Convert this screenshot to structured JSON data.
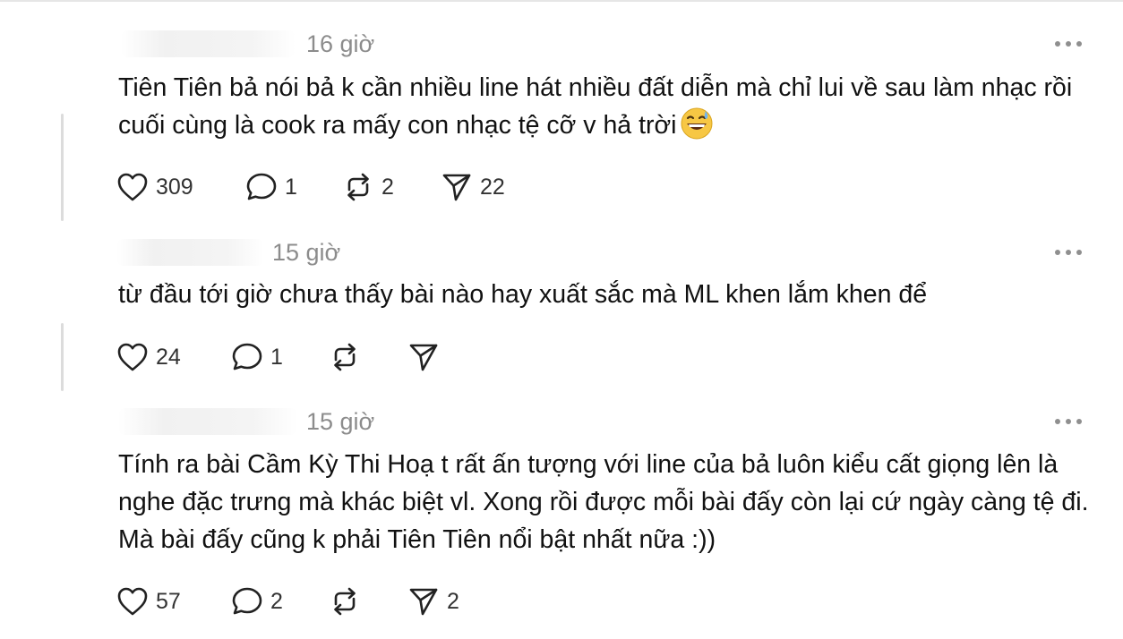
{
  "posts": [
    {
      "time": "16 giờ",
      "text": "Tiên Tiên bả nói bả k cần nhiều line hát nhiều đất diễn mà chỉ lui về sau làm nhạc rồi cuối cùng là cook ra mấy con nhạc tệ cỡ v hả trời",
      "emoji": "grinning-sweat-emoji",
      "likes": "309",
      "replies": "1",
      "reposts": "2",
      "shares": "22"
    },
    {
      "time": "15 giờ",
      "text": "từ đầu tới giờ chưa thấy bài nào hay xuất sắc mà ML khen lắm khen để",
      "likes": "24",
      "replies": "1",
      "reposts": "",
      "shares": ""
    },
    {
      "time": "15 giờ",
      "text": "Tính ra bài Cầm Kỳ Thi Hoạ t rất ấn tượng với line của bả luôn kiểu cất giọng lên là nghe đặc trưng mà khác biệt vl. Xong rồi được mỗi bài đấy còn lại cứ ngày càng tệ đi. Mà bài đấy cũng k phải Tiên Tiên nổi bật nhất nữa :))",
      "likes": "57",
      "replies": "2",
      "reposts": "",
      "shares": "2"
    }
  ],
  "icons": {
    "like": "heart-icon",
    "reply": "comment-bubble-icon",
    "repost": "repost-arrows-icon",
    "share": "send-paper-plane-icon",
    "more": "more-horizontal-icon"
  },
  "colors": {
    "text": "#111111",
    "muted": "#8c8c8c",
    "icon": "#222222",
    "thread_line": "#dcdcdc"
  }
}
